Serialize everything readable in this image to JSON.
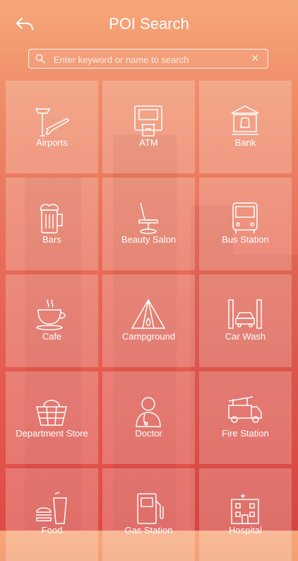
{
  "header": {
    "title": "POI Search",
    "back_icon": "back-arrow-icon"
  },
  "search": {
    "placeholder": "Enter keyword or name to search",
    "value": "",
    "clear_icon": "clear-icon"
  },
  "categories": [
    {
      "label": "Airports",
      "icon": "airport-icon"
    },
    {
      "label": "ATM",
      "icon": "atm-icon"
    },
    {
      "label": "Bank",
      "icon": "bank-icon"
    },
    {
      "label": "Bars",
      "icon": "beer-icon"
    },
    {
      "label": "Beauty Salon",
      "icon": "salon-chair-icon"
    },
    {
      "label": "Bus Station",
      "icon": "bus-icon"
    },
    {
      "label": "Cafe",
      "icon": "coffee-cup-icon"
    },
    {
      "label": "Campground",
      "icon": "tent-icon"
    },
    {
      "label": "Car Wash",
      "icon": "car-wash-icon"
    },
    {
      "label": "Department Store",
      "icon": "basket-icon"
    },
    {
      "label": "Doctor",
      "icon": "doctor-icon"
    },
    {
      "label": "Fire Station",
      "icon": "fire-truck-icon"
    },
    {
      "label": "Food",
      "icon": "food-icon"
    },
    {
      "label": "Gas Station",
      "icon": "gas-pump-icon"
    },
    {
      "label": "Hospital",
      "icon": "hospital-icon"
    }
  ],
  "colors": {
    "gradient_top": "#f6a77a",
    "gradient_bottom": "#df4a45",
    "tile": "rgba(255,255,255,0.22)"
  }
}
